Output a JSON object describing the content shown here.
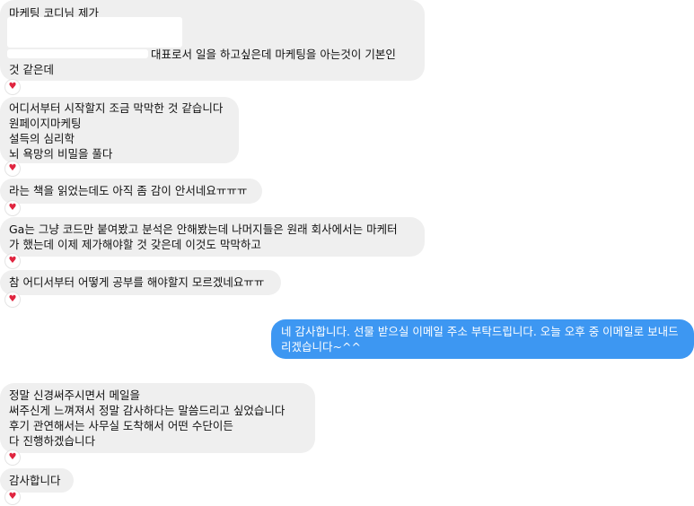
{
  "messages": [
    {
      "id": "m1",
      "side": "in",
      "lines": [
        "마케팅 코디님 제가",
        "대표로서 일을 하고싶은데 마케팅을 아는것이 기본인",
        "것 같은데"
      ],
      "reaction": "♥"
    },
    {
      "id": "m2",
      "side": "in",
      "lines": [
        "어디서부터 시작할지 조금 막막한 것 같습니다",
        "원페이지마케팅",
        "설득의 심리학",
        "뇌 욕망의 비밀을 풀다"
      ],
      "reaction": "♥"
    },
    {
      "id": "m3",
      "side": "in",
      "lines": [
        "라는 책을 읽었는데도 아직 좀 감이 안서네요ㅠㅠㅠ"
      ],
      "reaction": "♥"
    },
    {
      "id": "m4",
      "side": "in",
      "lines": [
        "Ga는 그냥 코드만 붙여봤고 분석은 안해봤는데 나머지들은 원래 회사에서는 마케터",
        "가 했는데 이제 제가해야할 것 갖은데 이것도 막막하고"
      ],
      "reaction": "♥"
    },
    {
      "id": "m5",
      "side": "in",
      "lines": [
        "참 어디서부터 어떻게 공부를 해야할지 모르겠네요ㅠㅠ"
      ],
      "reaction": "♥"
    },
    {
      "id": "m6",
      "side": "out",
      "lines": [
        "네 감사합니다. 선물 받으실 이메일 주소 부탁드립니다. 오늘 오후 중 이메일로 보내드",
        "리겠습니다~^^"
      ]
    },
    {
      "id": "m7",
      "side": "in",
      "lines": [
        "정말 신경써주시면서 메일을",
        "써주신게 느껴져서 정말 감사하다는 말씀드리고 싶었습니다",
        "후기 관연해서는 사무실 도착해서 어떤 수단이든",
        "다 진행하겠습니다"
      ],
      "reaction": "♥"
    },
    {
      "id": "m8",
      "side": "in",
      "lines": [
        "감사합니다"
      ],
      "reaction": "♥"
    }
  ]
}
